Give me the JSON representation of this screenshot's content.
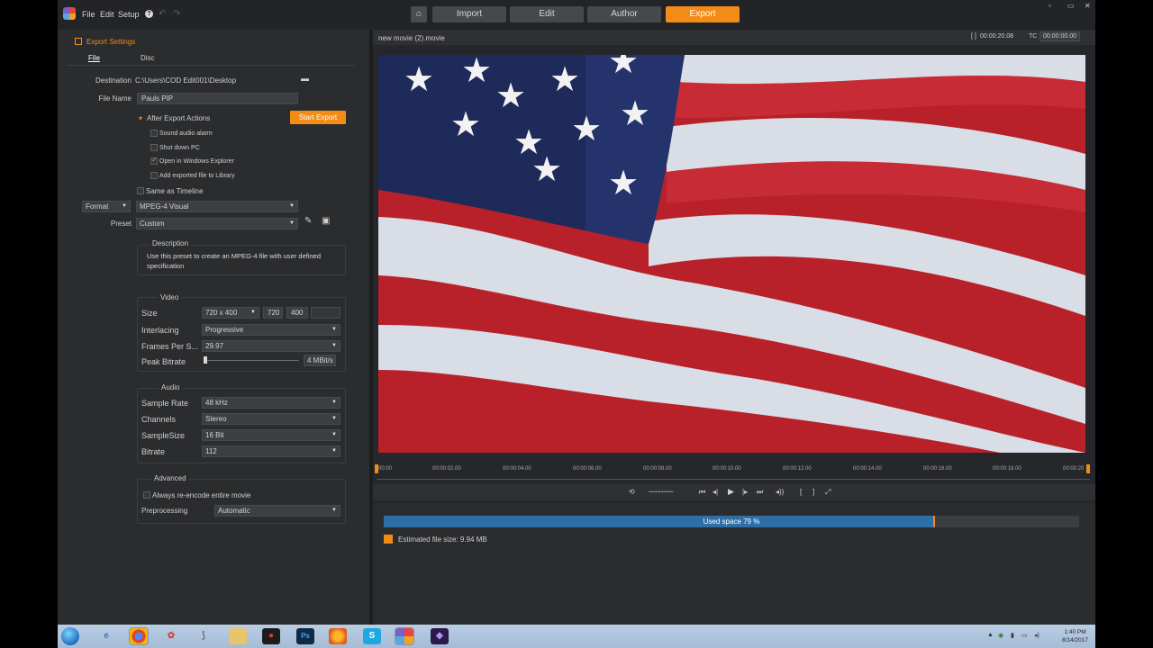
{
  "menu": {
    "file": "File",
    "edit": "Edit",
    "setup": "Setup",
    "help": "?"
  },
  "nav_tabs": [
    "Import",
    "Edit",
    "Author",
    "Export"
  ],
  "active_tab": "Export",
  "window_controls": [
    "▫",
    "▭",
    "✕"
  ],
  "export_panel": {
    "title": "Export Settings",
    "subtabs": [
      "File",
      "Disc"
    ],
    "destination_label": "Destination",
    "destination_value": "C:\\Users\\COD Edit001\\Desktop",
    "file_name_label": "File Name",
    "file_name_value": "Pauls PIP",
    "after_export_label": "After Export Actions",
    "start_export_label": "Start Export",
    "after_actions": [
      {
        "label": "Sound audio alarm",
        "checked": false
      },
      {
        "label": "Shut down PC",
        "checked": false
      },
      {
        "label": "Open in Windows Explorer",
        "checked": true
      },
      {
        "label": "Add exported file to Library",
        "checked": false
      }
    ],
    "same_as_timeline": "Same as Timeline",
    "format_label": "Format",
    "format_value": "MPEG-4 Visual",
    "preset_label": "Preset",
    "preset_value": "Custom",
    "description_title": "Description",
    "description_text": "Use this preset to create an MPEG-4 file with user defined specification",
    "video": {
      "title": "Video",
      "size_label": "Size",
      "size_value": "720 x 400",
      "width": "720",
      "height": "400",
      "interlacing_label": "Interlacing",
      "interlacing_value": "Progressive",
      "fps_label": "Frames Per S...",
      "fps_value": "29.97",
      "bitrate_label": "Peak Bitrate",
      "bitrate_value": "4  MBit/s"
    },
    "audio": {
      "title": "Audio",
      "sample_rate_label": "Sample Rate",
      "sample_rate_value": "48 kHz",
      "channels_label": "Channels",
      "channels_value": "Stereo",
      "samplesize_label": "SampleSize",
      "samplesize_value": "16 Bit",
      "bitrate_label": "Bitrate",
      "bitrate_value": "112"
    },
    "advanced": {
      "title": "Advanced",
      "reencode_label": "Always re-encode entire movie",
      "preprocessing_label": "Preprocessing",
      "preprocessing_value": "Automatic"
    }
  },
  "preview": {
    "movie_name": "new movie (2).movie",
    "timecode_label": "[ ]",
    "duration": "00:00:20.08",
    "tc_label": "TC",
    "tc_value": "00:00:00.00",
    "ruler_ticks": [
      "00:00",
      "00:00:02.00",
      "00:00:04.00",
      "00:00:06.00",
      "00:00:08.00",
      "00:00:10.00",
      "00:00:12.00",
      "00:00:14.00",
      "00:00:16.00",
      "00:00:18.00",
      "00:00:20"
    ]
  },
  "storage": {
    "used_text": "Used space 79 %",
    "used_fraction": 0.79,
    "estimated_text": "Estimated file size: 9.94 MB"
  },
  "taskbar": {
    "clock_time": "1:40 PM",
    "clock_date": "8/14/2017"
  },
  "colors": {
    "accent": "#f28c16",
    "used_space": "#2e6fa8",
    "flag_red": "#b8212a",
    "flag_blue": "#1e2a5a"
  }
}
